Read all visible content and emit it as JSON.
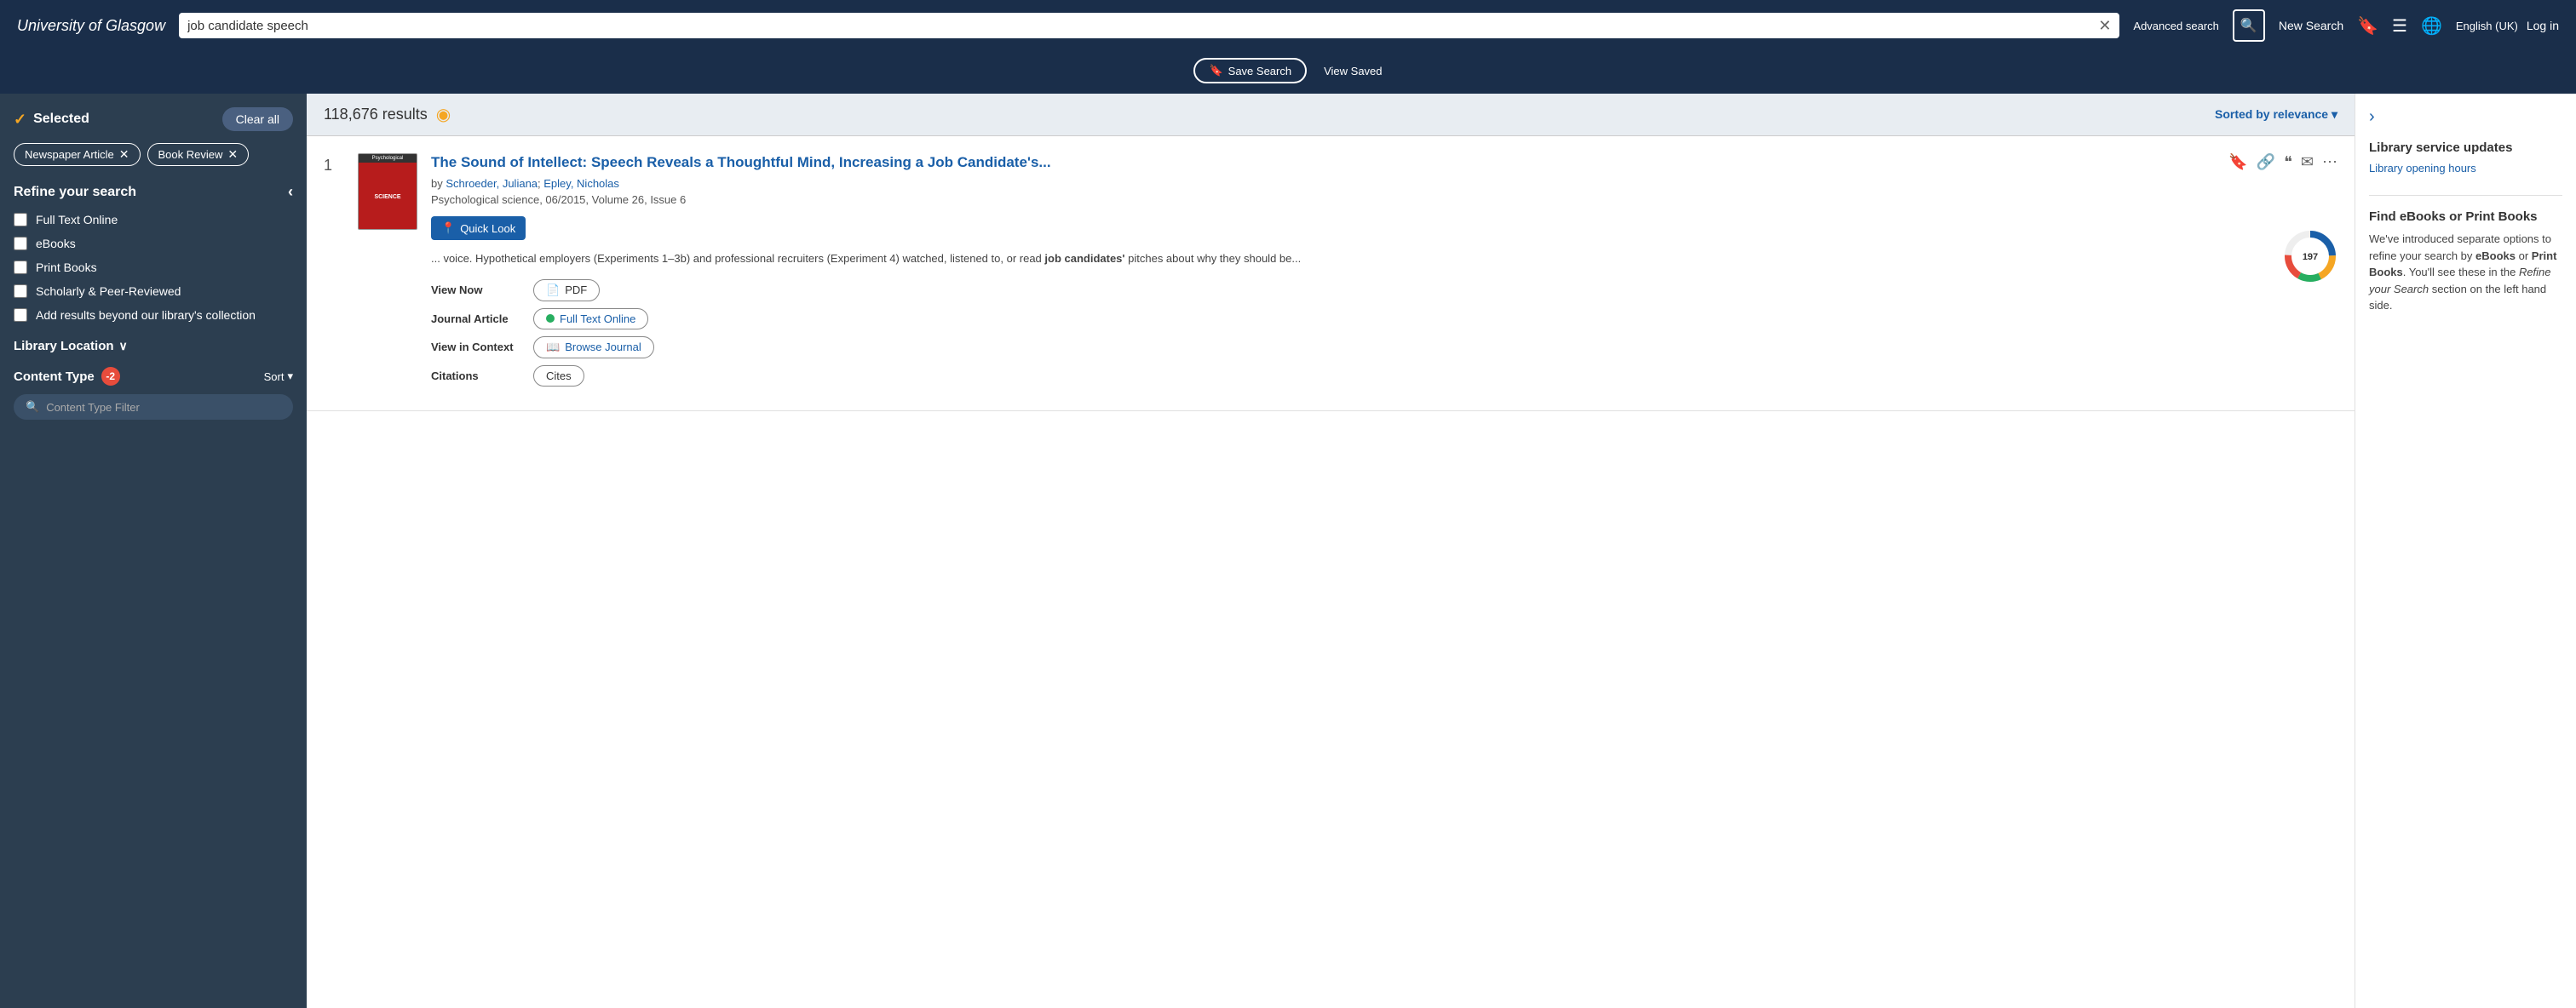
{
  "header": {
    "logo": "University of Glasgow",
    "search_query": "job candidate speech",
    "advanced_search": "Advanced search",
    "new_search": "New Search",
    "language": "English (UK)",
    "login": "Log in",
    "save_search": "Save Search",
    "view_saved": "View Saved"
  },
  "sidebar": {
    "selected_label": "Selected",
    "clear_all": "Clear all",
    "filter_tags": [
      {
        "label": "Newspaper Article",
        "id": "newspaper-tag"
      },
      {
        "label": "Book Review",
        "id": "book-review-tag"
      }
    ],
    "refine_title": "Refine your search",
    "options": [
      {
        "label": "Full Text Online",
        "checked": false
      },
      {
        "label": "eBooks",
        "checked": false
      },
      {
        "label": "Print Books",
        "checked": false
      },
      {
        "label": "Scholarly & Peer-Reviewed",
        "checked": false
      },
      {
        "label": "Add results beyond our library's collection",
        "checked": false
      }
    ],
    "library_location": "Library Location",
    "content_type": "Content Type",
    "content_type_badge": "-2",
    "sort_label": "Sort",
    "filter_placeholder": "Content Type Filter"
  },
  "results": {
    "count": "118,676 results",
    "sorted_by_label": "Sorted by",
    "sort_value": "relevance",
    "items": [
      {
        "number": "1",
        "title": "The Sound of Intellect: Speech Reveals a Thoughtful Mind, Increasing a Job Candidate's...",
        "authors": "Schroeder, Juliana; Epley, Nicholas",
        "journal": "Psychological science",
        "date": "06/2015",
        "volume": "Volume 26, Issue 6",
        "abstract": "... voice. Hypothetical employers (Experiments 1–3b) and professional recruiters (Experiment 4) watched, listened to, or read job candidates' pitches about why they should be...",
        "view_now_label": "View Now",
        "pdf_label": "PDF",
        "journal_article_label": "Journal Article",
        "full_text_online": "Full Text Online",
        "view_in_context_label": "View in Context",
        "browse_journal": "Browse Journal",
        "citations_label": "Citations",
        "cites_label": "Cites",
        "citation_count": "197",
        "quick_look": "Quick Look",
        "cover_text": "Psychological SCIENCE"
      }
    ]
  },
  "right_sidebar": {
    "toggle_icon": "›",
    "library_updates_title": "Library service updates",
    "library_opening_hours": "Library opening hours",
    "ebooks_title": "Find eBooks or Print Books",
    "ebooks_description": "We've introduced separate options to refine your search by",
    "ebooks_bold1": "eBooks",
    "ebooks_or": "or",
    "ebooks_bold2": "Print Books",
    "ebooks_suffix": ". You'll see these in the",
    "ebooks_italic": "Refine your Search",
    "ebooks_end": "section on the left hand side."
  },
  "icons": {
    "bookmark": "🔖",
    "menu": "☰",
    "globe": "🌐",
    "search": "🔍",
    "clear": "✕",
    "check": "✓",
    "rss": "◉",
    "link": "🔗",
    "quote": "❝",
    "email": "✉",
    "more": "⋯",
    "pin": "📍",
    "pdf": "📄",
    "journal": "📖",
    "collapse": "‹"
  }
}
